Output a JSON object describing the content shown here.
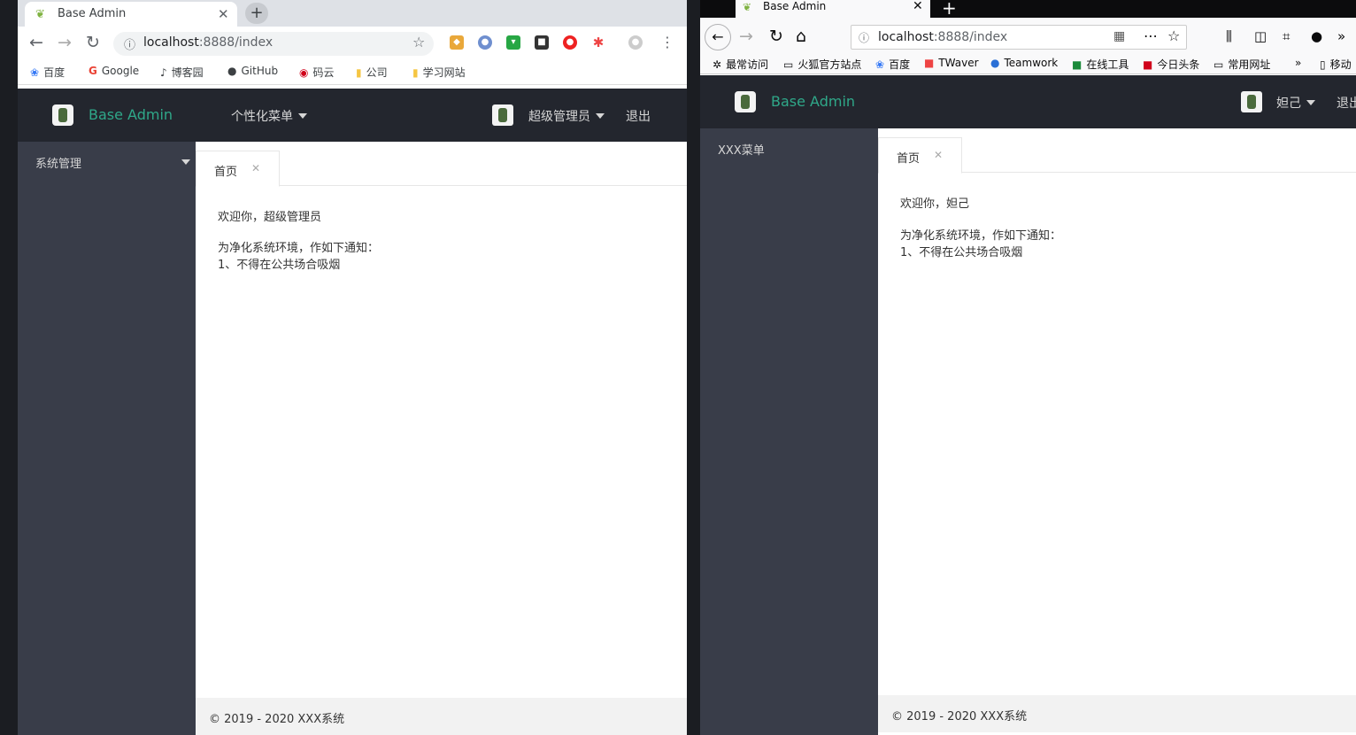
{
  "left": {
    "tab_title": "Base Admin",
    "url_host": "localhost",
    "url_rest": ":8888/index",
    "bookmarks": [
      "百度",
      "Google",
      "博客园",
      "GitHub",
      "码云",
      "公司",
      "学习网站"
    ],
    "app": {
      "brand": "Base Admin",
      "menu_label": "个性化菜单",
      "user_name": "超级管理员",
      "logout": "退出",
      "sidebar_item": "系统管理",
      "page_tab": "首页",
      "welcome": "欢迎你，超级管理员",
      "notice_title": "为净化系统环境，作如下通知：",
      "notice_item": "1、不得在公共场合吸烟",
      "footer": "© 2019 - 2020 XXX系统"
    }
  },
  "right": {
    "tab_title": "Base Admin",
    "url_host": "localhost",
    "url_rest": ":8888/index",
    "bookmarks": [
      "最常访问",
      "火狐官方站点",
      "百度",
      "TWaver",
      "Teamwork",
      "在线工具",
      "今日头条",
      "常用网址",
      "移动"
    ],
    "app": {
      "brand": "Base Admin",
      "user_name": "妲己",
      "logout": "退出",
      "sidebar_item": "XXX菜单",
      "page_tab": "首页",
      "welcome": "欢迎你，妲己",
      "notice_title": "为净化系统环境，作如下通知：",
      "notice_item": "1、不得在公共场合吸烟",
      "footer": "© 2019 - 2020 XXX系统"
    }
  },
  "colors": {
    "header_bg": "#23262e",
    "sidebar_bg": "#393d49",
    "brand": "#2fa889"
  }
}
